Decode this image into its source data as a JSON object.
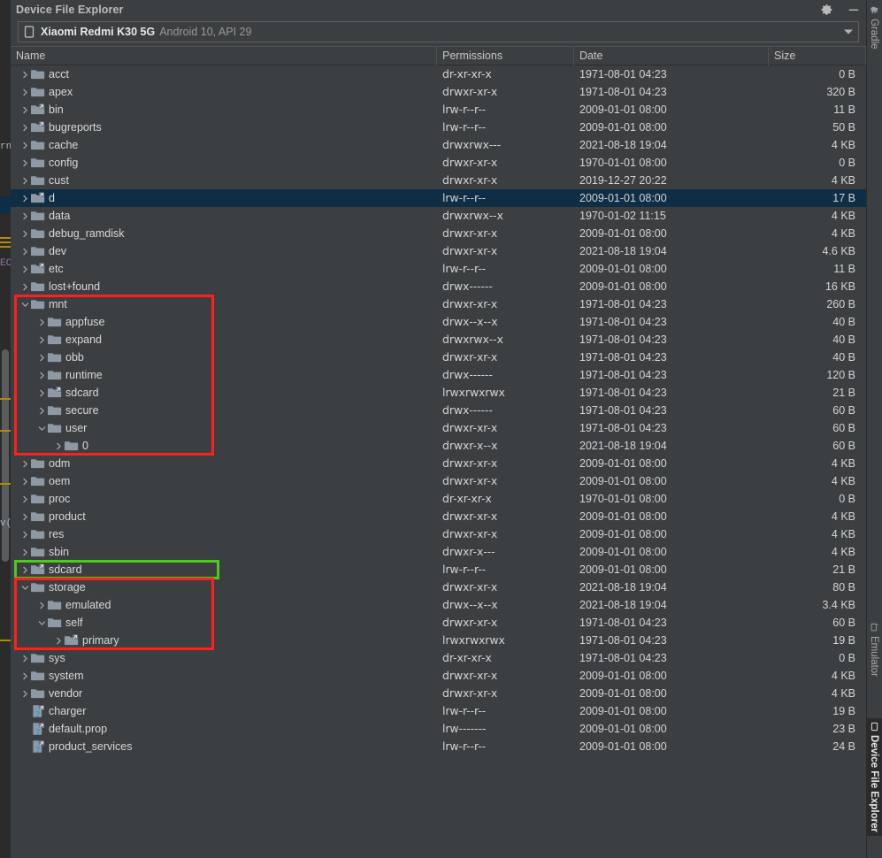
{
  "window": {
    "title": "Device File Explorer",
    "settings_icon": "gear-icon",
    "minimize_icon": "minimize-icon"
  },
  "device_selector": {
    "icon": "phone-icon",
    "name": "Xiaomi Redmi K30 5G",
    "meta": "Android 10, API 29",
    "dropdown_icon": "chevron-down-icon"
  },
  "columns": [
    {
      "key": "name",
      "label": "Name"
    },
    {
      "key": "perm",
      "label": "Permissions"
    },
    {
      "key": "date",
      "label": "Date"
    },
    {
      "key": "size",
      "label": "Size"
    }
  ],
  "rows": [
    {
      "name": "acct",
      "depth": 0,
      "twisty": "collapsed",
      "icon": "folder-icon",
      "perm": "dr-xr-xr-x",
      "date": "1971-08-01 04:23",
      "size": "0 B"
    },
    {
      "name": "apex",
      "depth": 0,
      "twisty": "collapsed",
      "icon": "folder-icon",
      "perm": "drwxr-xr-x",
      "date": "1971-08-01 04:23",
      "size": "320 B"
    },
    {
      "name": "bin",
      "depth": 0,
      "twisty": "collapsed",
      "icon": "folder-link-icon",
      "perm": "lrw-r--r--",
      "date": "2009-01-01 08:00",
      "size": "11 B"
    },
    {
      "name": "bugreports",
      "depth": 0,
      "twisty": "collapsed",
      "icon": "folder-link-icon",
      "perm": "lrw-r--r--",
      "date": "2009-01-01 08:00",
      "size": "50 B"
    },
    {
      "name": "cache",
      "depth": 0,
      "twisty": "collapsed",
      "icon": "folder-icon",
      "perm": "drwxrwx---",
      "date": "2021-08-18 19:04",
      "size": "4 KB"
    },
    {
      "name": "config",
      "depth": 0,
      "twisty": "collapsed",
      "icon": "folder-icon",
      "perm": "drwxr-xr-x",
      "date": "1970-01-01 08:00",
      "size": "0 B"
    },
    {
      "name": "cust",
      "depth": 0,
      "twisty": "collapsed",
      "icon": "folder-icon",
      "perm": "drwxr-xr-x",
      "date": "2019-12-27 20:22",
      "size": "4 KB"
    },
    {
      "name": "d",
      "depth": 0,
      "twisty": "collapsed",
      "icon": "folder-link-icon",
      "perm": "lrw-r--r--",
      "date": "2009-01-01 08:00",
      "size": "17 B",
      "selected": true
    },
    {
      "name": "data",
      "depth": 0,
      "twisty": "collapsed",
      "icon": "folder-icon",
      "perm": "drwxrwx--x",
      "date": "1970-01-02 11:15",
      "size": "4 KB"
    },
    {
      "name": "debug_ramdisk",
      "depth": 0,
      "twisty": "collapsed",
      "icon": "folder-icon",
      "perm": "drwxr-xr-x",
      "date": "2009-01-01 08:00",
      "size": "4 KB"
    },
    {
      "name": "dev",
      "depth": 0,
      "twisty": "collapsed",
      "icon": "folder-icon",
      "perm": "drwxr-xr-x",
      "date": "2021-08-18 19:04",
      "size": "4.6 KB"
    },
    {
      "name": "etc",
      "depth": 0,
      "twisty": "collapsed",
      "icon": "folder-link-icon",
      "perm": "lrw-r--r--",
      "date": "2009-01-01 08:00",
      "size": "11 B"
    },
    {
      "name": "lost+found",
      "depth": 0,
      "twisty": "collapsed",
      "icon": "folder-icon",
      "perm": "drwx------",
      "date": "2009-01-01 08:00",
      "size": "16 KB"
    },
    {
      "name": "mnt",
      "depth": 0,
      "twisty": "expanded",
      "icon": "folder-icon",
      "perm": "drwxr-xr-x",
      "date": "1971-08-01 04:23",
      "size": "260 B"
    },
    {
      "name": "appfuse",
      "depth": 1,
      "twisty": "collapsed",
      "icon": "folder-icon",
      "perm": "drwx--x--x",
      "date": "1971-08-01 04:23",
      "size": "40 B"
    },
    {
      "name": "expand",
      "depth": 1,
      "twisty": "collapsed",
      "icon": "folder-icon",
      "perm": "drwxrwx--x",
      "date": "1971-08-01 04:23",
      "size": "40 B"
    },
    {
      "name": "obb",
      "depth": 1,
      "twisty": "collapsed",
      "icon": "folder-icon",
      "perm": "drwxr-xr-x",
      "date": "1971-08-01 04:23",
      "size": "40 B"
    },
    {
      "name": "runtime",
      "depth": 1,
      "twisty": "collapsed",
      "icon": "folder-icon",
      "perm": "drwx------",
      "date": "1971-08-01 04:23",
      "size": "120 B"
    },
    {
      "name": "sdcard",
      "depth": 1,
      "twisty": "collapsed",
      "icon": "folder-link-icon",
      "perm": "lrwxrwxrwx",
      "date": "1971-08-01 04:23",
      "size": "21 B"
    },
    {
      "name": "secure",
      "depth": 1,
      "twisty": "collapsed",
      "icon": "folder-icon",
      "perm": "drwx------",
      "date": "1971-08-01 04:23",
      "size": "60 B"
    },
    {
      "name": "user",
      "depth": 1,
      "twisty": "expanded",
      "icon": "folder-icon",
      "perm": "drwxr-xr-x",
      "date": "1971-08-01 04:23",
      "size": "60 B"
    },
    {
      "name": "0",
      "depth": 2,
      "twisty": "collapsed",
      "icon": "folder-icon",
      "perm": "drwxr-x--x",
      "date": "2021-08-18 19:04",
      "size": "60 B"
    },
    {
      "name": "odm",
      "depth": 0,
      "twisty": "collapsed",
      "icon": "folder-icon",
      "perm": "drwxr-xr-x",
      "date": "2009-01-01 08:00",
      "size": "4 KB"
    },
    {
      "name": "oem",
      "depth": 0,
      "twisty": "collapsed",
      "icon": "folder-icon",
      "perm": "drwxr-xr-x",
      "date": "2009-01-01 08:00",
      "size": "4 KB"
    },
    {
      "name": "proc",
      "depth": 0,
      "twisty": "collapsed",
      "icon": "folder-icon",
      "perm": "dr-xr-xr-x",
      "date": "1970-01-01 08:00",
      "size": "0 B"
    },
    {
      "name": "product",
      "depth": 0,
      "twisty": "collapsed",
      "icon": "folder-icon",
      "perm": "drwxr-xr-x",
      "date": "2009-01-01 08:00",
      "size": "4 KB"
    },
    {
      "name": "res",
      "depth": 0,
      "twisty": "collapsed",
      "icon": "folder-icon",
      "perm": "drwxr-xr-x",
      "date": "2009-01-01 08:00",
      "size": "4 KB"
    },
    {
      "name": "sbin",
      "depth": 0,
      "twisty": "collapsed",
      "icon": "folder-icon",
      "perm": "drwxr-x---",
      "date": "2009-01-01 08:00",
      "size": "4 KB"
    },
    {
      "name": "sdcard",
      "depth": 0,
      "twisty": "collapsed",
      "icon": "folder-link-icon",
      "perm": "lrw-r--r--",
      "date": "2009-01-01 08:00",
      "size": "21 B"
    },
    {
      "name": "storage",
      "depth": 0,
      "twisty": "expanded",
      "icon": "folder-icon",
      "perm": "drwxr-xr-x",
      "date": "2021-08-18 19:04",
      "size": "80 B"
    },
    {
      "name": "emulated",
      "depth": 1,
      "twisty": "collapsed",
      "icon": "folder-icon",
      "perm": "drwx--x--x",
      "date": "2021-08-18 19:04",
      "size": "3.4 KB"
    },
    {
      "name": "self",
      "depth": 1,
      "twisty": "expanded",
      "icon": "folder-icon",
      "perm": "drwxr-xr-x",
      "date": "1971-08-01 04:23",
      "size": "60 B"
    },
    {
      "name": "primary",
      "depth": 2,
      "twisty": "collapsed",
      "icon": "folder-link-icon",
      "perm": "lrwxrwxrwx",
      "date": "1971-08-01 04:23",
      "size": "19 B"
    },
    {
      "name": "sys",
      "depth": 0,
      "twisty": "collapsed",
      "icon": "folder-icon",
      "perm": "dr-xr-xr-x",
      "date": "1971-08-01 04:23",
      "size": "0 B"
    },
    {
      "name": "system",
      "depth": 0,
      "twisty": "collapsed",
      "icon": "folder-icon",
      "perm": "drwxr-xr-x",
      "date": "2009-01-01 08:00",
      "size": "4 KB"
    },
    {
      "name": "vendor",
      "depth": 0,
      "twisty": "collapsed",
      "icon": "folder-icon",
      "perm": "drwxr-xr-x",
      "date": "2009-01-01 08:00",
      "size": "4 KB"
    },
    {
      "name": "charger",
      "depth": 0,
      "twisty": "none",
      "icon": "unknown-file-link-icon",
      "perm": "lrw-r--r--",
      "date": "2009-01-01 08:00",
      "size": "19 B"
    },
    {
      "name": "default.prop",
      "depth": 0,
      "twisty": "none",
      "icon": "unknown-file-link-icon",
      "perm": "lrw-------",
      "date": "2009-01-01 08:00",
      "size": "23 B"
    },
    {
      "name": "product_services",
      "depth": 0,
      "twisty": "none",
      "icon": "unknown-file-link-icon",
      "perm": "lrw-r--r--",
      "date": "2009-01-01 08:00",
      "size": "24 B"
    }
  ],
  "annotations": [
    {
      "id": "mnt-subtree-highlight",
      "color": "#ff1f1f",
      "shape": "rect"
    },
    {
      "id": "sdcard-row-highlight",
      "color": "#4fc820",
      "shape": "rect"
    },
    {
      "id": "storage-subtree-highlight",
      "color": "#ff1f1f",
      "shape": "rect"
    }
  ],
  "right_tool_tabs": [
    {
      "id": "gradle",
      "label": "Gradle",
      "icon": "elephant-icon",
      "active": false
    },
    {
      "id": "emulator",
      "label": "Emulator",
      "icon": "device-icon",
      "active": false
    },
    {
      "id": "device-file-explorer",
      "label": "Device File Explorer",
      "icon": "phone-icon",
      "active": true
    }
  ],
  "theme": {
    "background": "#3c3f41",
    "selection": "#0f2d44",
    "text": "#d4d4d4",
    "folder": "#8d9aa6",
    "annotation_red": "#ff1f1f",
    "annotation_green": "#4fc820"
  }
}
